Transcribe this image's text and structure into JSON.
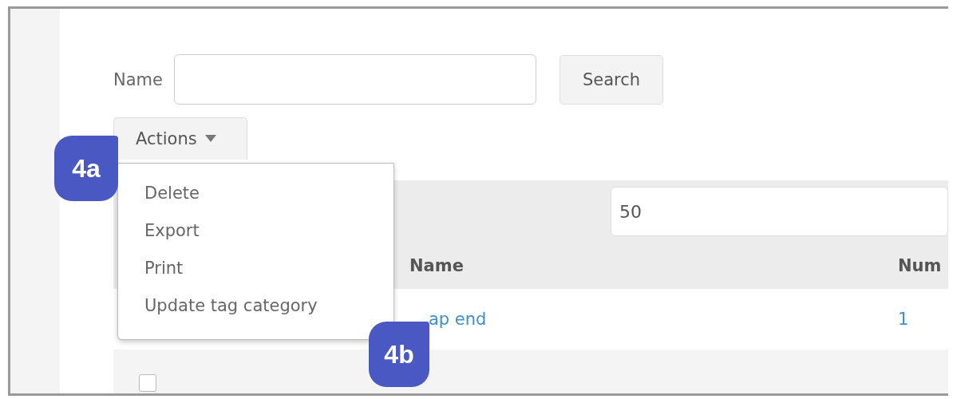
{
  "search": {
    "label": "Name",
    "button": "Search"
  },
  "actions": {
    "label": "Actions",
    "expanded": true,
    "menu": [
      {
        "label": "Delete"
      },
      {
        "label": "Export"
      },
      {
        "label": "Print"
      },
      {
        "label": "Update tag category"
      }
    ]
  },
  "callouts": [
    "4a",
    "4b"
  ],
  "page_size": {
    "value": "50"
  },
  "table": {
    "columns": [
      "Name",
      "Num"
    ],
    "rows": [
      {
        "name": "ap end",
        "num": "1"
      }
    ],
    "partial_row": {
      "checked": false
    }
  }
}
